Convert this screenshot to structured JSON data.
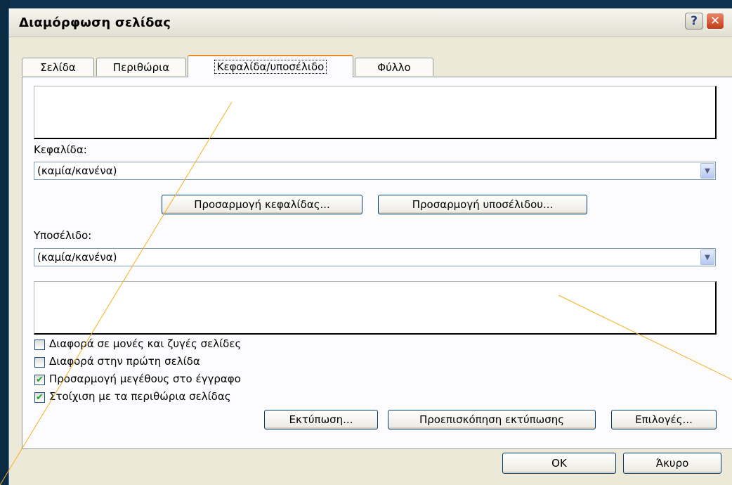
{
  "window": {
    "title": "Διαμόρφωση σελίδας",
    "help_label": "?",
    "close_label": "✕"
  },
  "tabs": [
    {
      "label": "Σελίδα",
      "active": false
    },
    {
      "label": "Περιθώρια",
      "active": false
    },
    {
      "label": "Κεφαλίδα/υποσέλιδο",
      "active": true
    },
    {
      "label": "Φύλλο",
      "active": false
    }
  ],
  "header": {
    "label": "Κεφαλίδα:",
    "value": "(καμία/κανένα)",
    "customize_label": "Προσαρμογή κεφαλίδας..."
  },
  "footer": {
    "label": "Υποσέλιδο:",
    "value": "(καμία/κανένα)",
    "customize_label": "Προσαρμογή υποσέλιδου..."
  },
  "options": [
    {
      "label": "Διαφορά σε μονές και ζυγές σελίδες",
      "checked": false
    },
    {
      "label": "Διαφορά στην πρώτη σελίδα",
      "checked": false
    },
    {
      "label": "Προσαρμογή μεγέθους στο έγγραφο",
      "checked": true
    },
    {
      "label": "Στοίχιση με τα περιθώρια σελίδας",
      "checked": true
    }
  ],
  "actions": {
    "print": "Εκτύπωση...",
    "print_preview": "Προεπισκόπηση εκτύπωσης",
    "options": "Επιλογές..."
  },
  "dialog_buttons": {
    "ok": "OK",
    "cancel": "Άκυρο"
  },
  "colors": {
    "callout_line": "#f5b21a",
    "check_mark": "#21a121"
  }
}
